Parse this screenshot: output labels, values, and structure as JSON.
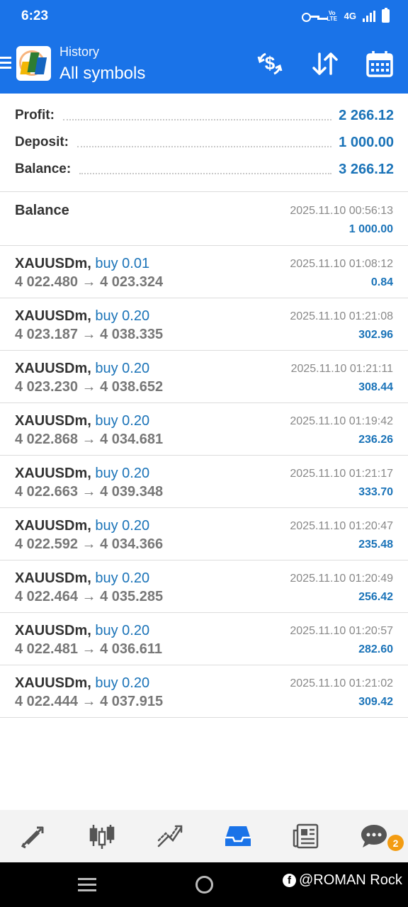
{
  "status_bar": {
    "time": "6:23",
    "network_label": "4G",
    "volte_label": "Vo LTE",
    "icons": [
      "key-icon",
      "volte-icon",
      "signal-icon",
      "battery-icon"
    ]
  },
  "app_bar": {
    "subtitle": "History",
    "title": "All symbols",
    "actions": [
      "dollar-exchange-icon",
      "sort-icon",
      "calendar-icon"
    ],
    "accent_color": "#1a73e8"
  },
  "summary": {
    "profit_label": "Profit:",
    "profit_value": "2 266.12",
    "deposit_label": "Deposit:",
    "deposit_value": "1 000.00",
    "balance_label": "Balance:",
    "balance_value": "3 266.12"
  },
  "balance_entry": {
    "title": "Balance",
    "time": "2025.11.10 00:56:13",
    "amount": "1 000.00"
  },
  "deals": [
    {
      "symbol": "XAUUSDm,",
      "side": "buy 0.01",
      "open": "4 022.480",
      "close": "4 023.324",
      "time": "2025.11.10 01:08:12",
      "profit": "0.84"
    },
    {
      "symbol": "XAUUSDm,",
      "side": "buy 0.20",
      "open": "4 023.187",
      "close": "4 038.335",
      "time": "2025.11.10 01:21:08",
      "profit": "302.96"
    },
    {
      "symbol": "XAUUSDm,",
      "side": "buy 0.20",
      "open": "4 023.230",
      "close": "4 038.652",
      "time": "2025.11.10 01:21:11",
      "profit": "308.44"
    },
    {
      "symbol": "XAUUSDm,",
      "side": "buy 0.20",
      "open": "4 022.868",
      "close": "4 034.681",
      "time": "2025.11.10 01:19:42",
      "profit": "236.26"
    },
    {
      "symbol": "XAUUSDm,",
      "side": "buy 0.20",
      "open": "4 022.663",
      "close": "4 039.348",
      "time": "2025.11.10 01:21:17",
      "profit": "333.70"
    },
    {
      "symbol": "XAUUSDm,",
      "side": "buy 0.20",
      "open": "4 022.592",
      "close": "4 034.366",
      "time": "2025.11.10 01:20:47",
      "profit": "235.48"
    },
    {
      "symbol": "XAUUSDm,",
      "side": "buy 0.20",
      "open": "4 022.464",
      "close": "4 035.285",
      "time": "2025.11.10 01:20:49",
      "profit": "256.42"
    },
    {
      "symbol": "XAUUSDm,",
      "side": "buy 0.20",
      "open": "4 022.481",
      "close": "4 036.611",
      "time": "2025.11.10 01:20:57",
      "profit": "282.60"
    },
    {
      "symbol": "XAUUSDm,",
      "side": "buy 0.20",
      "open": "4 022.444",
      "close": "4 037.915",
      "time": "2025.11.10 01:21:02",
      "profit": "309.42"
    }
  ],
  "arrow": "→",
  "bottom_nav": {
    "items": [
      "quotes-icon",
      "chart-icon",
      "trade-icon",
      "history-icon",
      "news-icon",
      "chat-icon"
    ],
    "active": "history-icon",
    "chat_badge": "2"
  },
  "system_nav": {
    "watermark": "@ROMAN Rock",
    "fb_glyph": "f"
  }
}
